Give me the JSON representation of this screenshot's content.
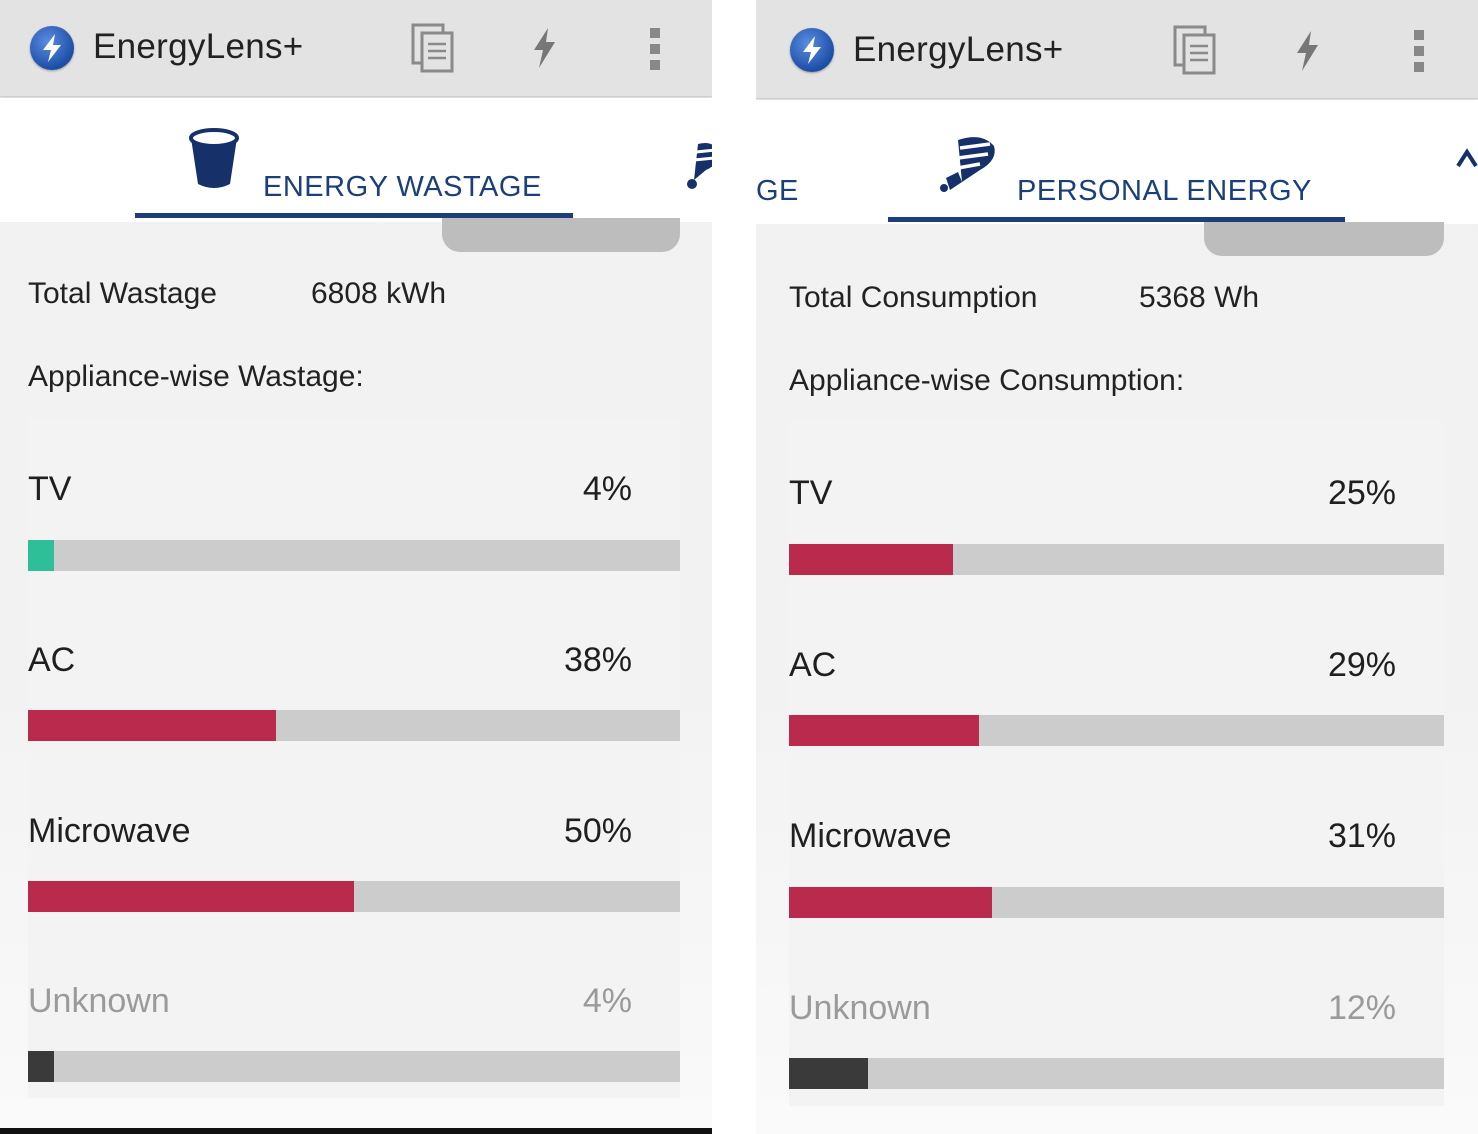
{
  "app": {
    "title": "EnergyLens+"
  },
  "icons": {
    "logo": "lightning-bolt-logo-icon",
    "copy": "copy-document-icon",
    "bolt": "lightning-bolt-icon",
    "menu": "overflow-menu-icon",
    "bucket": "wastage-bucket-icon",
    "person": "personal-energy-icon"
  },
  "colors": {
    "accent": "#1b3f7a",
    "bar_red": "#b92a4c",
    "bar_teal": "#2fbf98",
    "bar_dark": "#3a3a3a",
    "track": "#cccccc"
  },
  "left_screen": {
    "tab": {
      "label": "ENERGY WASTAGE"
    },
    "summary": {
      "label": "Total Wastage",
      "value": "6808 kWh"
    },
    "section_heading": "Appliance-wise Wastage:",
    "appliances": [
      {
        "name": "TV",
        "percent_label": "4%",
        "percent": 4,
        "color": "#2fbf98",
        "muted": false
      },
      {
        "name": "AC",
        "percent_label": "38%",
        "percent": 38,
        "color": "#b92a4c",
        "muted": false
      },
      {
        "name": "Microwave",
        "percent_label": "50%",
        "percent": 50,
        "color": "#b92a4c",
        "muted": false
      },
      {
        "name": "Unknown",
        "percent_label": "4%",
        "percent": 4,
        "color": "#3a3a3a",
        "muted": true
      }
    ]
  },
  "right_screen": {
    "prev_tab_fragment": "GE",
    "tab": {
      "label": "PERSONAL ENERGY"
    },
    "summary": {
      "label": "Total Consumption",
      "value": "5368 Wh"
    },
    "section_heading": "Appliance-wise Consumption:",
    "appliances": [
      {
        "name": "TV",
        "percent_label": "25%",
        "percent": 25,
        "color": "#b92a4c",
        "muted": false
      },
      {
        "name": "AC",
        "percent_label": "29%",
        "percent": 29,
        "color": "#b92a4c",
        "muted": false
      },
      {
        "name": "Microwave",
        "percent_label": "31%",
        "percent": 31,
        "color": "#b92a4c",
        "muted": false
      },
      {
        "name": "Unknown",
        "percent_label": "12%",
        "percent": 12,
        "color": "#3a3a3a",
        "muted": true
      }
    ]
  }
}
